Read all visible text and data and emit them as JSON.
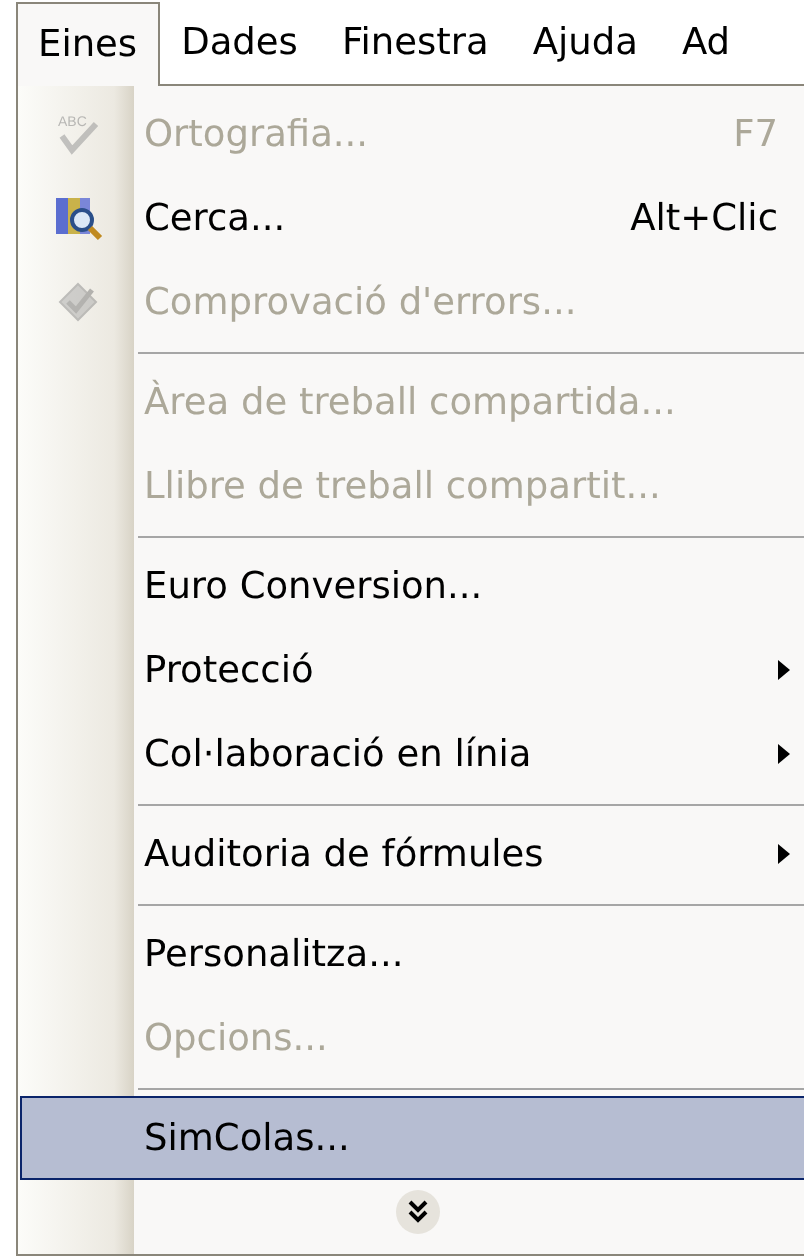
{
  "menu_bar": [
    {
      "label": "Eines",
      "selected": true
    },
    {
      "label": "Dades",
      "selected": false
    },
    {
      "label": "Finestra",
      "selected": false
    },
    {
      "label": "Ajuda",
      "selected": false
    },
    {
      "label": "Ad",
      "selected": false
    }
  ],
  "menu": [
    {
      "kind": "item",
      "icon_label": "ABC",
      "label": "Ortografia...",
      "shortcut": "F7",
      "disabled": true,
      "submenu": false,
      "selected": false
    },
    {
      "kind": "item",
      "label": "Cerca...",
      "shortcut": "Alt+Clic",
      "disabled": false,
      "submenu": false,
      "selected": false
    },
    {
      "kind": "item",
      "label": "Comprovació d'errors...",
      "disabled": true,
      "submenu": false,
      "selected": false
    },
    {
      "kind": "separator"
    },
    {
      "kind": "item",
      "label": "Àrea de treball compartida...",
      "disabled": true,
      "submenu": false,
      "selected": false
    },
    {
      "kind": "item",
      "label": "Llibre de treball compartit...",
      "disabled": true,
      "submenu": false,
      "selected": false
    },
    {
      "kind": "separator"
    },
    {
      "kind": "item",
      "label": "Euro Conversion...",
      "disabled": false,
      "submenu": false,
      "selected": false
    },
    {
      "kind": "item",
      "label": "Protecció",
      "disabled": false,
      "submenu": true,
      "selected": false
    },
    {
      "kind": "item",
      "label": "Col·laboració en línia",
      "disabled": false,
      "submenu": true,
      "selected": false
    },
    {
      "kind": "separator"
    },
    {
      "kind": "item",
      "label": "Auditoria de fórmules",
      "disabled": false,
      "submenu": true,
      "selected": false
    },
    {
      "kind": "separator"
    },
    {
      "kind": "item",
      "label": "Personalitza...",
      "disabled": false,
      "submenu": false,
      "selected": false
    },
    {
      "kind": "item",
      "label": "Opcions...",
      "disabled": true,
      "submenu": false,
      "selected": false
    },
    {
      "kind": "separator"
    },
    {
      "kind": "item",
      "label": "SimColas...",
      "disabled": false,
      "submenu": false,
      "selected": true
    },
    {
      "kind": "expand"
    }
  ]
}
